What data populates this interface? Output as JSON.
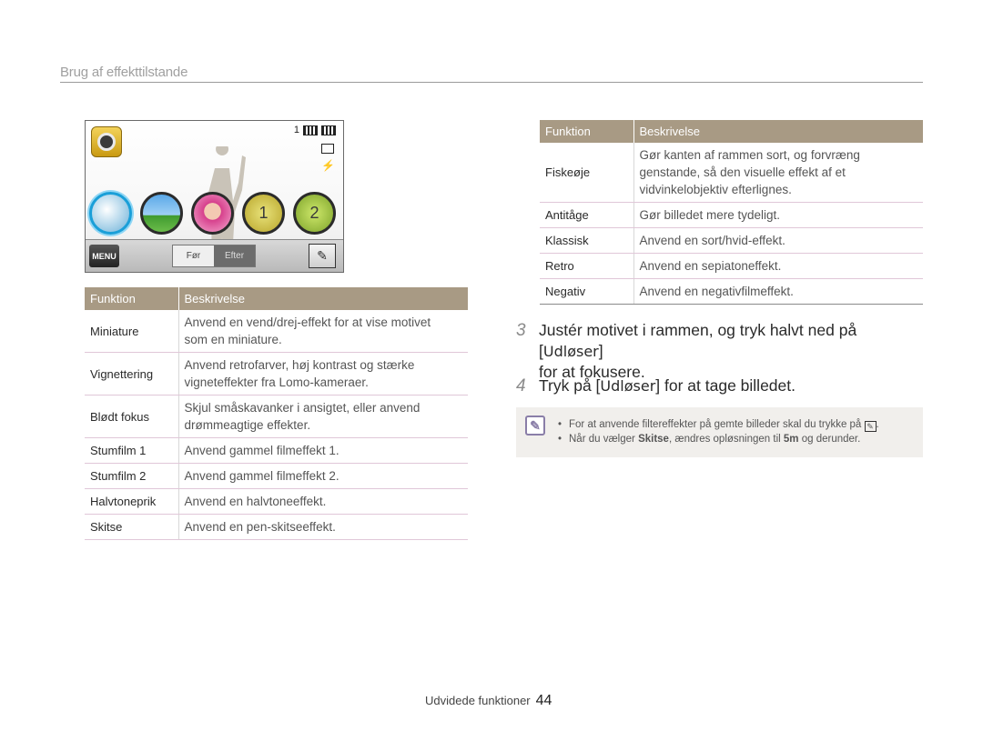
{
  "header": {
    "title": "Brug af effekttilstande"
  },
  "camera_screen": {
    "status_shots": "1",
    "thumbnails": [
      {
        "icon": "miniature-icon",
        "label": ""
      },
      {
        "icon": "landscape-icon",
        "label": ""
      },
      {
        "icon": "portrait-icon",
        "label": ""
      },
      {
        "icon": "film1-icon",
        "label": "1"
      },
      {
        "icon": "film2-icon",
        "label": "2"
      }
    ],
    "menu_label": "MENU",
    "before_label": "Før",
    "after_label": "Efter"
  },
  "left_table": {
    "headers": [
      "Funktion",
      "Beskrivelse"
    ],
    "rows": [
      {
        "name": "Miniature",
        "desc1": "Anvend en vend/drej-effekt for at vise motivet",
        "desc2": "som en miniature."
      },
      {
        "name": "Vignettering",
        "desc1": "Anvend retrofarver, høj kontrast og stærke",
        "desc2": "vigneteffekter fra Lomo-kameraer."
      },
      {
        "name": "Blødt fokus",
        "desc1": "Skjul småskavanker i ansigtet, eller anvend",
        "desc2": "drømmeagtige effekter."
      },
      {
        "name": "Stumfilm 1",
        "desc1": "Anvend gammel filmeffekt 1."
      },
      {
        "name": "Stumfilm 2",
        "desc1": "Anvend gammel filmeffekt 2."
      },
      {
        "name": "Halvtoneprik",
        "desc1": "Anvend en halvtoneeffekt."
      },
      {
        "name": "Skitse",
        "desc1": "Anvend en pen-skitseeffekt."
      }
    ]
  },
  "right_table": {
    "headers": [
      "Funktion",
      "Beskrivelse"
    ],
    "rows": [
      {
        "name": "Fiskeøje",
        "desc1": "Gør kanten af rammen sort, og forvræng",
        "desc2": "genstande, så den visuelle effekt af et",
        "desc3": "vidvinkelobjektiv efterlignes."
      },
      {
        "name": "Antitåge",
        "desc1": "Gør billedet mere tydeligt."
      },
      {
        "name": "Klassisk",
        "desc1": "Anvend en sort/hvid-effekt."
      },
      {
        "name": "Retro",
        "desc1": "Anvend en sepiatoneffekt."
      },
      {
        "name": "Negativ",
        "desc1": "Anvend en negativfilmeffekt."
      }
    ]
  },
  "steps": [
    {
      "num": "3",
      "pre": "Justér motivet i rammen, og tryk halvt ned på [",
      "key": "Udløser",
      "post": "]",
      "line2": "for at fokusere."
    },
    {
      "num": "4",
      "pre": "Tryk på [",
      "key": "Udløser",
      "post": "] for at tage billedet."
    }
  ],
  "note": {
    "item1": "For at anvende filtereffekter på gemte billeder skal du trykke på",
    "item1_end": ".",
    "item2_pre": "Når du vælger ",
    "item2_key": "Skitse",
    "item2_mid": ", ændres opløsningen til ",
    "item2_res": "5m",
    "item2_post": " og derunder."
  },
  "footer": {
    "label": "Udvidede funktioner",
    "page": "44"
  }
}
